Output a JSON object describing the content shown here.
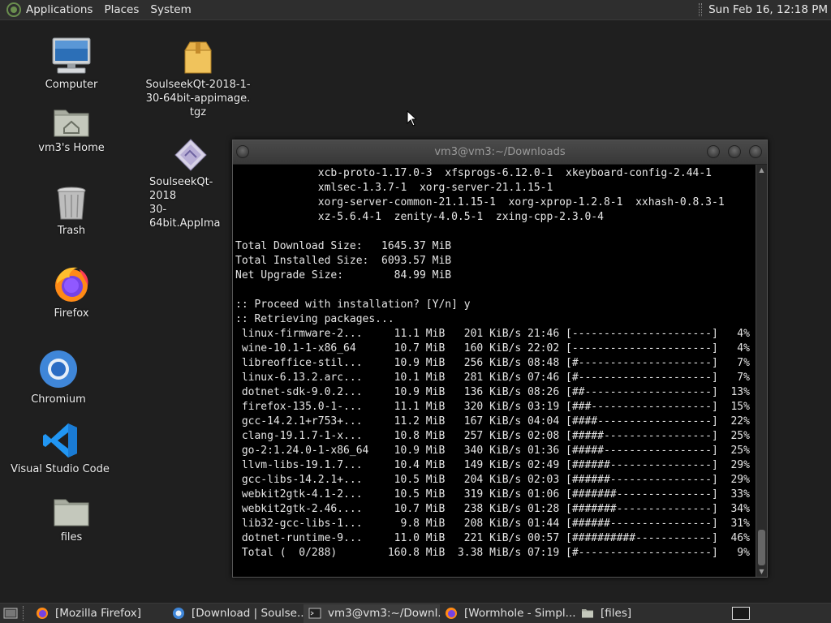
{
  "top_panel": {
    "menus": [
      "Applications",
      "Places",
      "System"
    ],
    "clock": "Sun Feb 16, 12:18 PM"
  },
  "desktop": {
    "icons": [
      {
        "label": "Computer",
        "icon": "computer-icon"
      },
      {
        "label": "vm3's Home",
        "icon": "home-folder-icon"
      },
      {
        "label": "Trash",
        "icon": "trash-icon"
      },
      {
        "label": "Firefox",
        "icon": "firefox-icon"
      },
      {
        "label": "Chromium",
        "icon": "chromium-icon"
      },
      {
        "label": "Visual Studio Code",
        "icon": "vscode-icon"
      },
      {
        "label": "files",
        "icon": "folder-icon"
      },
      {
        "label": "SoulseekQt-2018-1-30-64bit-appimage.tgz",
        "label_lines": [
          "SoulseekQt-2018-1-",
          "30-64bit-appimage.",
          "tgz"
        ],
        "icon": "archive-icon"
      },
      {
        "label": "SoulseekQt-2018-1-30-64bit.AppImage",
        "label_lines": [
          "SoulseekQt-2018",
          "30-64bit.AppIma"
        ],
        "icon": "appimage-icon"
      }
    ]
  },
  "terminal": {
    "title": "vm3@vm3:~/Downloads",
    "lines": [
      "             xcb-proto-1.17.0-3  xfsprogs-6.12.0-1  xkeyboard-config-2.44-1",
      "             xmlsec-1.3.7-1  xorg-server-21.1.15-1",
      "             xorg-server-common-21.1.15-1  xorg-xprop-1.2.8-1  xxhash-0.8.3-1",
      "             xz-5.6.4-1  zenity-4.0.5-1  zxing-cpp-2.3.0-4",
      "",
      "Total Download Size:   1645.37 MiB",
      "Total Installed Size:  6093.57 MiB",
      "Net Upgrade Size:        84.99 MiB",
      "",
      ":: Proceed with installation? [Y/n] y",
      ":: Retrieving packages...",
      " linux-firmware-2...     11.1 MiB   201 KiB/s 21:46 [----------------------]   4%",
      " wine-10.1-1-x86_64      10.7 MiB   160 KiB/s 22:02 [----------------------]   4%",
      " libreoffice-stil...     10.9 MiB   256 KiB/s 08:48 [#---------------------]   7%",
      " linux-6.13.2.arc...     10.1 MiB   281 KiB/s 07:46 [#---------------------]   7%",
      " dotnet-sdk-9.0.2...     10.9 MiB   136 KiB/s 08:26 [##--------------------]  13%",
      " firefox-135.0-1-...     11.1 MiB   320 KiB/s 03:19 [###-------------------]  15%",
      " gcc-14.2.1+r753+...     11.2 MiB   167 KiB/s 04:04 [####------------------]  22%",
      " clang-19.1.7-1-x...     10.8 MiB   257 KiB/s 02:08 [#####-----------------]  25%",
      " go-2:1.24.0-1-x86_64    10.9 MiB   340 KiB/s 01:36 [#####-----------------]  25%",
      " llvm-libs-19.1.7...     10.4 MiB   149 KiB/s 02:49 [######----------------]  29%",
      " gcc-libs-14.2.1+...     10.5 MiB   204 KiB/s 02:03 [######----------------]  29%",
      " webkit2gtk-4.1-2...     10.5 MiB   319 KiB/s 01:06 [#######---------------]  33%",
      " webkit2gtk-2.46....     10.7 MiB   238 KiB/s 01:28 [#######---------------]  34%",
      " lib32-gcc-libs-1...      9.8 MiB   208 KiB/s 01:44 [######----------------]  31%",
      " dotnet-runtime-9...     11.0 MiB   221 KiB/s 00:57 [##########------------]  46%",
      " Total (  0/288)        160.8 MiB  3.38 MiB/s 07:19 [#---------------------]   9%"
    ]
  },
  "taskbar": {
    "tasks": [
      {
        "label": "[Mozilla Firefox]",
        "icon": "firefox-icon"
      },
      {
        "label": "[Download | Soulse...",
        "icon": "chromium-icon"
      },
      {
        "label": "vm3@vm3:~/Downl...",
        "icon": "terminal-icon",
        "active": true
      },
      {
        "label": "[Wormhole - Simpl...",
        "icon": "firefox-icon"
      },
      {
        "label": "[files]",
        "icon": "folder-icon"
      }
    ]
  }
}
